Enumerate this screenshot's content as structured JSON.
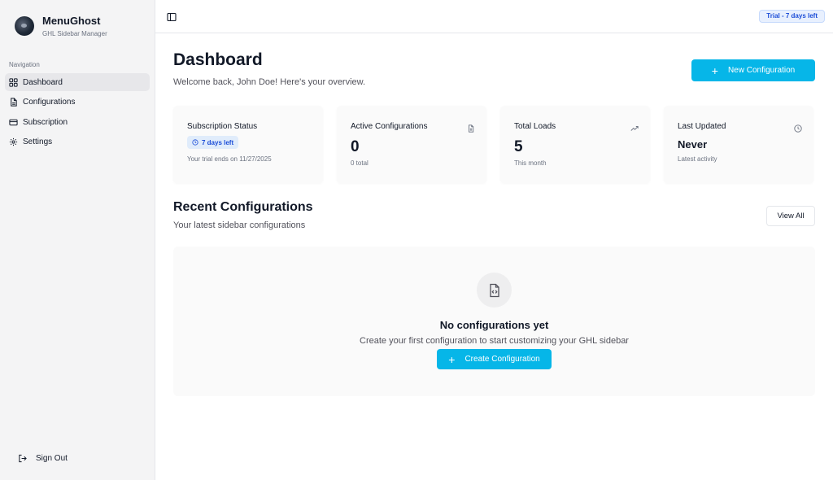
{
  "brand": {
    "name": "MenuGhost",
    "subtitle": "GHL Sidebar Manager"
  },
  "sidebar": {
    "heading": "Navigation",
    "items": [
      {
        "label": "Dashboard",
        "icon": "grid-icon",
        "active": true
      },
      {
        "label": "Configurations",
        "icon": "file-icon",
        "active": false
      },
      {
        "label": "Subscription",
        "icon": "credit-card-icon",
        "active": false
      },
      {
        "label": "Settings",
        "icon": "gear-icon",
        "active": false
      }
    ],
    "sign_out": "Sign Out"
  },
  "topbar": {
    "trial_badge": "Trial - 7 days left"
  },
  "header": {
    "title": "Dashboard",
    "subtitle": "Welcome back, John Doe! Here's your overview.",
    "new_button": "New Configuration"
  },
  "cards": {
    "subscription": {
      "title": "Subscription Status",
      "badge": "7 days left",
      "note": "Your trial ends on 11/27/2025"
    },
    "active": {
      "title": "Active Configurations",
      "value": "0",
      "note": "0 total"
    },
    "loads": {
      "title": "Total Loads",
      "value": "5",
      "note": "This month"
    },
    "updated": {
      "title": "Last Updated",
      "value": "Never",
      "note": "Latest activity"
    }
  },
  "recent": {
    "title": "Recent Configurations",
    "subtitle": "Your latest sidebar configurations",
    "view_all": "View All",
    "empty_title": "No configurations yet",
    "empty_sub": "Create your first configuration to start customizing your GHL sidebar",
    "create_button": "Create Configuration"
  },
  "colors": {
    "accent": "#06b6e8",
    "badge_text": "#1d4ed8",
    "badge_bg": "#e8f0fe",
    "sidebar_bg": "#f4f4f5"
  }
}
